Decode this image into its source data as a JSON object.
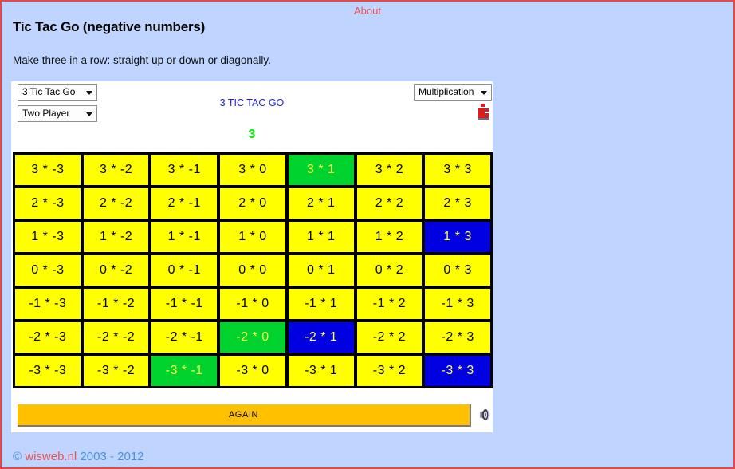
{
  "header": {
    "about_label": "About",
    "title": "Tic Tac Go (negative numbers)",
    "subtitle": "Make three in a row: straight up or down or diagonally."
  },
  "colors": {
    "page_background": "#bfd5ff",
    "page_border": "#e04a4a",
    "panel_background": "#ffffff",
    "cell_empty": "#ffff00",
    "cell_green": "#00d22e",
    "cell_blue": "#0000e0",
    "cell_text": "#000000",
    "cell_marked_text": "#ffff44",
    "applet_title": "#2222dd",
    "score": "#00ee00",
    "again_button": "#ffc000",
    "link_red": "#e8544f",
    "footer_blue": "#4a90e2"
  },
  "controls": {
    "mode_select": {
      "value": "3 Tic Tac Go",
      "options": [
        "3 Tic Tac Go"
      ]
    },
    "players_select": {
      "value": "Two Player",
      "options": [
        "Two Player"
      ]
    },
    "operation_select": {
      "value": "Multiplication",
      "options": [
        "Multiplication"
      ]
    },
    "info_icon": "info-icon"
  },
  "applet": {
    "title": "3 TIC TAC GO",
    "score": "3"
  },
  "board": {
    "rows": 7,
    "cols": 7,
    "row_labels": [
      "3",
      "2",
      "1",
      "0",
      "-1",
      "-2",
      "-3"
    ],
    "col_labels": [
      "-3",
      "-2",
      "-1",
      "0",
      "1",
      "2",
      "3"
    ],
    "operator": "*",
    "cells": [
      [
        {
          "label": "3 * -3",
          "state": "empty"
        },
        {
          "label": "3 * -2",
          "state": "empty"
        },
        {
          "label": "3 * -1",
          "state": "empty"
        },
        {
          "label": "3 * 0",
          "state": "empty"
        },
        {
          "label": "3 * 1",
          "state": "green"
        },
        {
          "label": "3 * 2",
          "state": "empty"
        },
        {
          "label": "3 * 3",
          "state": "empty"
        }
      ],
      [
        {
          "label": "2 * -3",
          "state": "empty"
        },
        {
          "label": "2 * -2",
          "state": "empty"
        },
        {
          "label": "2 * -1",
          "state": "empty"
        },
        {
          "label": "2 * 0",
          "state": "empty"
        },
        {
          "label": "2 * 1",
          "state": "empty"
        },
        {
          "label": "2 * 2",
          "state": "empty"
        },
        {
          "label": "2 * 3",
          "state": "empty"
        }
      ],
      [
        {
          "label": "1 * -3",
          "state": "empty"
        },
        {
          "label": "1 * -2",
          "state": "empty"
        },
        {
          "label": "1 * -1",
          "state": "empty"
        },
        {
          "label": "1 * 0",
          "state": "empty"
        },
        {
          "label": "1 * 1",
          "state": "empty"
        },
        {
          "label": "1 * 2",
          "state": "empty"
        },
        {
          "label": "1 * 3",
          "state": "blue"
        }
      ],
      [
        {
          "label": "0 * -3",
          "state": "empty"
        },
        {
          "label": "0 * -2",
          "state": "empty"
        },
        {
          "label": "0 * -1",
          "state": "empty"
        },
        {
          "label": "0 * 0",
          "state": "empty"
        },
        {
          "label": "0 * 1",
          "state": "empty"
        },
        {
          "label": "0 * 2",
          "state": "empty"
        },
        {
          "label": "0 * 3",
          "state": "empty"
        }
      ],
      [
        {
          "label": "-1 * -3",
          "state": "empty"
        },
        {
          "label": "-1 * -2",
          "state": "empty"
        },
        {
          "label": "-1 * -1",
          "state": "empty"
        },
        {
          "label": "-1 * 0",
          "state": "empty"
        },
        {
          "label": "-1 * 1",
          "state": "empty"
        },
        {
          "label": "-1 * 2",
          "state": "empty"
        },
        {
          "label": "-1 * 3",
          "state": "empty"
        }
      ],
      [
        {
          "label": "-2 * -3",
          "state": "empty"
        },
        {
          "label": "-2 * -2",
          "state": "empty"
        },
        {
          "label": "-2 * -1",
          "state": "empty"
        },
        {
          "label": "-2 * 0",
          "state": "green"
        },
        {
          "label": "-2 * 1",
          "state": "blue"
        },
        {
          "label": "-2 * 2",
          "state": "empty"
        },
        {
          "label": "-2 * 3",
          "state": "empty"
        }
      ],
      [
        {
          "label": "-3 * -3",
          "state": "empty"
        },
        {
          "label": "-3 * -2",
          "state": "empty"
        },
        {
          "label": "-3 * -1",
          "state": "green"
        },
        {
          "label": "-3 * 0",
          "state": "empty"
        },
        {
          "label": "-3 * 1",
          "state": "empty"
        },
        {
          "label": "-3 * 2",
          "state": "empty"
        },
        {
          "label": "-3 * 3",
          "state": "blue"
        }
      ]
    ]
  },
  "actions": {
    "again_label": "AGAIN",
    "sound_icon": "speaker-icon"
  },
  "footer": {
    "copyright_symbol": "©",
    "site": "wisweb.nl",
    "years": "2003 - 2012"
  }
}
